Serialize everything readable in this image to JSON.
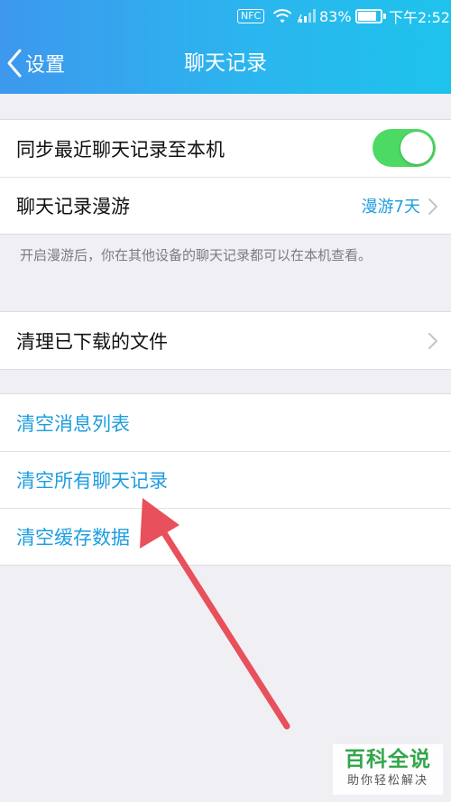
{
  "status_bar": {
    "nfc_label": "NFC",
    "battery": "83%",
    "time": "下午2:52",
    "battery_level": 0.83
  },
  "nav": {
    "back_label": "设置",
    "title": "聊天记录"
  },
  "settings": {
    "sync_label": "同步最近聊天记录至本机",
    "sync_enabled": true,
    "roaming_label": "聊天记录漫游",
    "roaming_value": "漫游7天",
    "roaming_note": "开启漫游后，你在其他设备的聊天记录都可以在本机查看。",
    "clear_downloaded_label": "清理已下载的文件"
  },
  "actions": {
    "clear_message_list": "清空消息列表",
    "clear_all_chats": "清空所有聊天记录",
    "clear_cache": "清空缓存数据"
  },
  "watermark": {
    "main": "百科全说",
    "sub": "助你轻松解决"
  },
  "colors": {
    "header_start": "#3d98ee",
    "header_end": "#1ec3ec",
    "toggle_on": "#4cd964",
    "link_blue": "#1e9ddf",
    "annotation_arrow": "#e8505b",
    "watermark_green": "#33a64a"
  }
}
